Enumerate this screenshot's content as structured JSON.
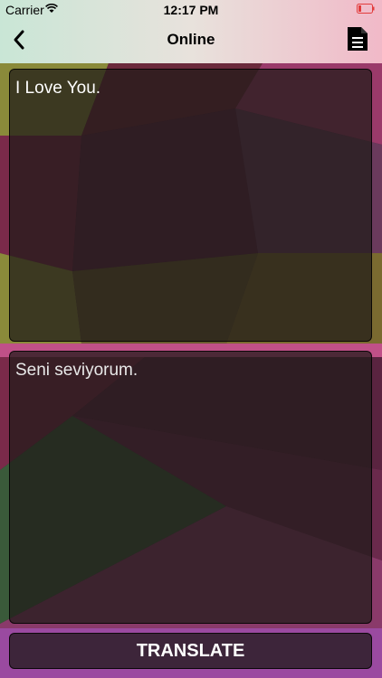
{
  "status_bar": {
    "carrier": "Carrier",
    "time": "12:17 PM",
    "icons": [
      "wifi-icon",
      "battery-icon"
    ],
    "battery_color": "#e23b3b"
  },
  "navbar": {
    "title": "Online",
    "back_icon": "chevron-left-icon",
    "action_icon": "document-icon"
  },
  "translator": {
    "source_text": "I Love You.",
    "translated_text": "Seni seviyorum.",
    "translate_label": "TRANSLATE"
  },
  "colors": {
    "panel_bg": "#1e1a18",
    "text": "#ffffff"
  }
}
